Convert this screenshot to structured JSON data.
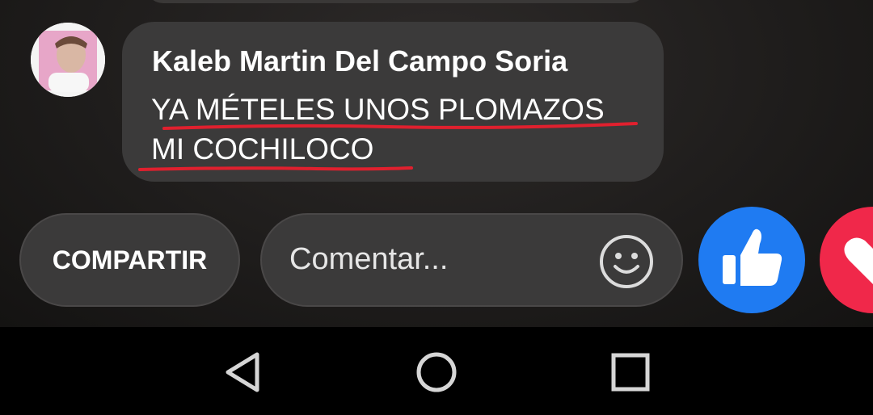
{
  "comment": {
    "author": "Kaleb Martin Del Campo Soria",
    "text_line1": "YA MÉTELES UNOS PLOMAZOS",
    "text_line2": "MI COCHILOCO",
    "underline_color": "#e0202e"
  },
  "actions": {
    "share_label": "COMPARTIR",
    "comment_placeholder": "Comentar...",
    "emoji_icon": "smiley-icon",
    "like_icon": "thumbs-up-icon",
    "love_icon": "heart-icon",
    "like_color": "#1f7bf2",
    "love_color": "#f0284a"
  },
  "nav": {
    "back_icon": "triangle-back-icon",
    "home_icon": "circle-home-icon",
    "recents_icon": "square-recents-icon"
  }
}
